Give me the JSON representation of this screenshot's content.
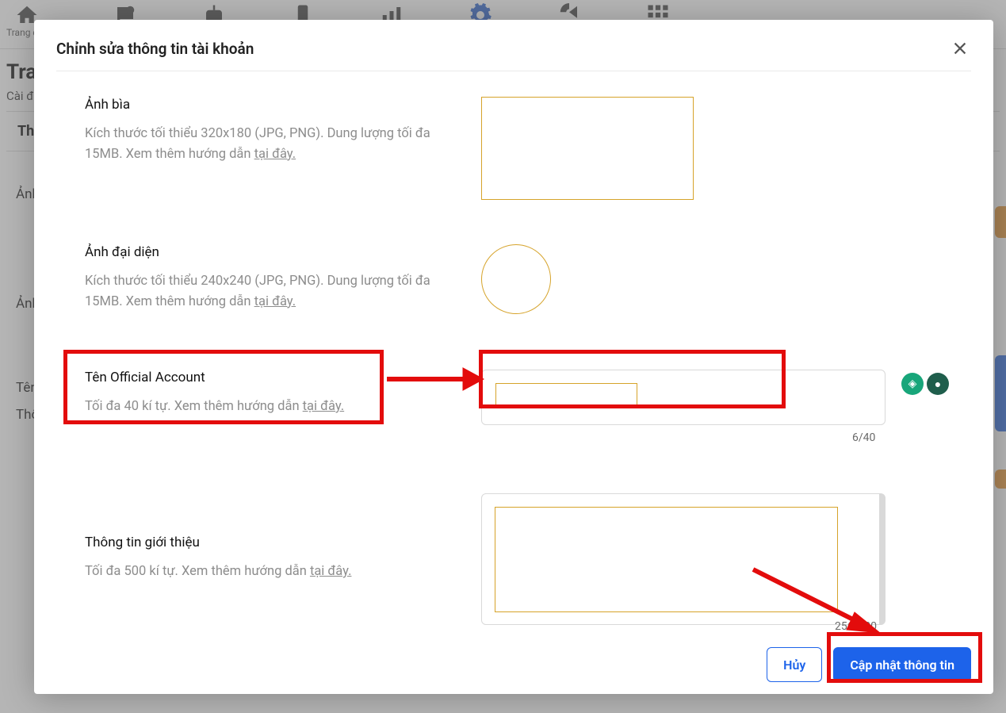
{
  "background": {
    "nav": {
      "home": "Trang chủ"
    },
    "pageTitlePrefix": "Tran",
    "breadcrumb": "Cài đặt",
    "tab": "Thông",
    "labels": {
      "cover": "Ảnh",
      "avatar": "Ảnh",
      "name": "Tên",
      "info": "Thô"
    }
  },
  "modal": {
    "title": "Chỉnh sửa thông tin tài khoản",
    "sections": {
      "cover": {
        "label": "Ảnh bìa",
        "hint_pre": "Kích thước tối thiểu 320x180 (JPG, PNG). Dung lượng tối đa 15MB. Xem thêm hướng dẫn ",
        "hint_link": "tại đây."
      },
      "avatar": {
        "label": "Ảnh đại diện",
        "hint_pre": "Kích thước tối thiểu 240x240 (JPG, PNG). Dung lượng tối đa 15MB. Xem thêm hướng dẫn ",
        "hint_link": "tại đây."
      },
      "name": {
        "label": "Tên Official Account",
        "hint_pre": "Tối đa 40 kí tự. Xem thêm hướng dẫn ",
        "hint_link": "tại đây.",
        "counter": "6/40"
      },
      "intro": {
        "label": "Thông tin giới thiệu",
        "hint_pre": "Tối đa 500 kí tự. Xem thêm hướng dẫn ",
        "hint_link": "tại đây.",
        "counter": "256/500"
      }
    },
    "actions": {
      "cancel": "Hủy",
      "submit": "Cập nhật thông tin"
    }
  }
}
